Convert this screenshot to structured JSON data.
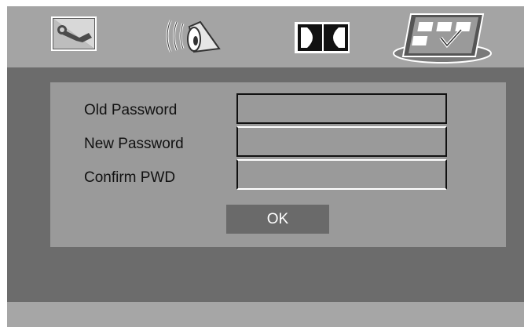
{
  "menu": {
    "tabs": [
      {
        "name": "general-setup",
        "icon": "wrench-icon"
      },
      {
        "name": "audio-setup",
        "icon": "speaker-icon"
      },
      {
        "name": "dolby-setup",
        "icon": "dolby-icon"
      },
      {
        "name": "preference-setup",
        "icon": "checklist-icon",
        "selected": true
      }
    ]
  },
  "password_dialog": {
    "old_password_label": "Old Password",
    "new_password_label": "New Password",
    "confirm_label": "Confirm PWD",
    "old_password_value": "",
    "new_password_value": "",
    "confirm_value": "",
    "ok_label": "OK"
  },
  "colors": {
    "screen_bg": "#6c6c6c",
    "bar_bg": "#a4a4a4",
    "panel_bg": "#9a9a9a",
    "button_bg": "#6a6a6a"
  }
}
